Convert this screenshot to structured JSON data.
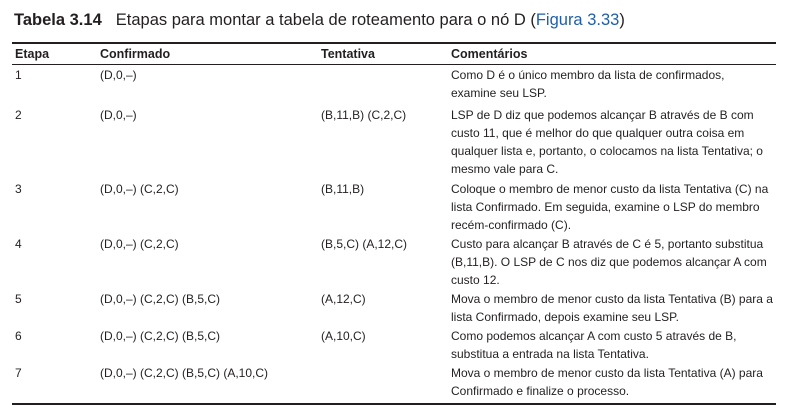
{
  "table": {
    "number": "Tabela 3.14",
    "caption_text": "Etapas para montar a tabela de roteamento para o nó D (",
    "caption_ref": "Figura 3.33",
    "caption_end": ")",
    "headers": {
      "etapa": "Etapa",
      "confirmado": "Confirmado",
      "tentativa": "Tentativa",
      "comentarios": "Comentários"
    },
    "rows": [
      {
        "etapa": "1",
        "confirmado": "(D,0,–)",
        "tentativa": "",
        "comentarios": "Como D é o único membro da lista de confirmados, examine seu LSP."
      },
      {
        "etapa": "2",
        "confirmado": "(D,0,–)",
        "tentativa": "(B,11,B) (C,2,C)",
        "comentarios": "LSP de D diz que podemos alcançar B através de B com custo 11, que é melhor do que qualquer outra coisa em qualquer lista e, portanto, o colocamos na lista Tentativa; o mesmo vale para C."
      },
      {
        "etapa": "3",
        "confirmado": "(D,0,–) (C,2,C)",
        "tentativa": "(B,11,B)",
        "comentarios": "Coloque o membro de menor custo da lista Tentativa (C) na lista Confirmado. Em seguida, examine o LSP do membro recém-confirmado (C)."
      },
      {
        "etapa": "4",
        "confirmado": "(D,0,–) (C,2,C)",
        "tentativa": "(B,5,C) (A,12,C)",
        "comentarios": "Custo para alcançar B através de C é 5, portanto substitua (B,11,B). O LSP de C nos diz que podemos alcançar A com custo 12."
      },
      {
        "etapa": "5",
        "confirmado": "(D,0,–) (C,2,C) (B,5,C)",
        "tentativa": "(A,12,C)",
        "comentarios": "Mova o membro de menor custo da lista Tentativa (B) para a lista Confirmado, depois examine seu LSP."
      },
      {
        "etapa": "6",
        "confirmado": "(D,0,–) (C,2,C) (B,5,C)",
        "tentativa": "(A,10,C)",
        "comentarios": "Como podemos alcançar A com custo 5 através de B, substitua a entrada na lista Tentativa."
      },
      {
        "etapa": "7",
        "confirmado": "(D,0,–) (C,2,C) (B,5,C) (A,10,C)",
        "tentativa": "",
        "comentarios": "Mova o membro de menor custo da lista Tentativa (A) para Confirmado e finalize o processo."
      }
    ]
  }
}
